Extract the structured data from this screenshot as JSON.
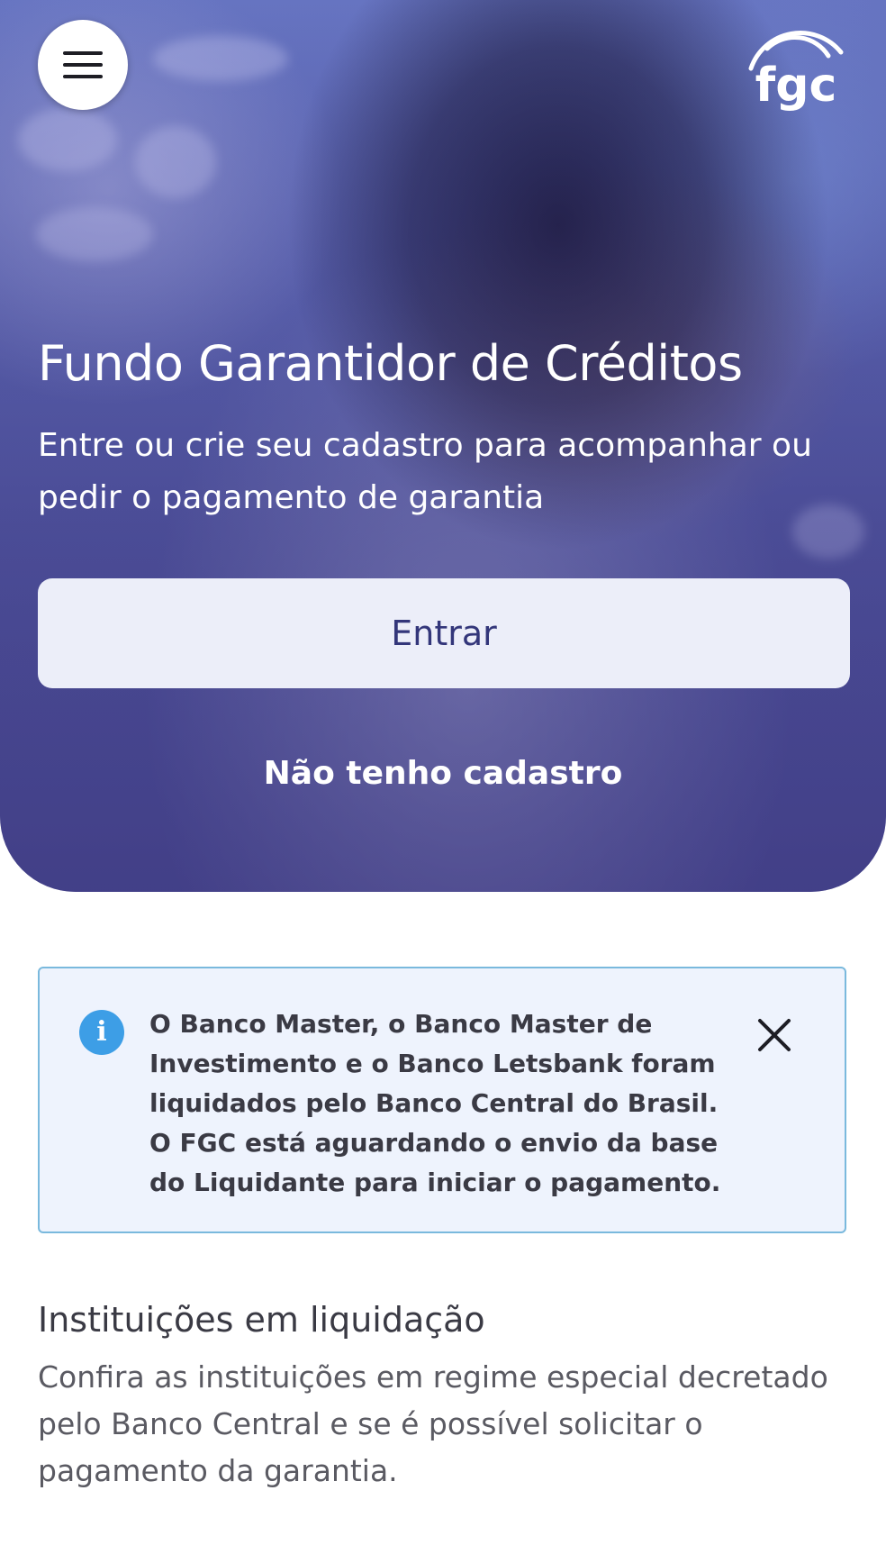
{
  "header": {
    "menu_icon": "hamburger-menu-icon",
    "logo_text": "fgc"
  },
  "hero": {
    "title": "Fundo Garantidor de Créditos",
    "subtitle": "Entre ou crie seu cadastro para acompanhar ou pedir o pagamento de garantia",
    "login_label": "Entrar",
    "register_label": "Não tenho cadastro"
  },
  "alert": {
    "icon": "info-icon",
    "message": "O Banco Master, o Banco Master de Investimento e o Banco Letsbank foram liquidados pelo Banco Central do Brasil. O FGC está aguardando o envio da base do Liquidante para iniciar o pagamento.",
    "close_icon": "close-icon"
  },
  "liquidation_section": {
    "title": "Instituições em liquidação",
    "description": "Confira as instituições em regime especial decretado pelo Banco Central e se é possível solicitar o pagamento da garantia."
  },
  "colors": {
    "hero_overlay": "#4f539b",
    "button_bg": "#eceef9",
    "button_text": "#33367a",
    "alert_border": "#7ab9dd",
    "alert_bg": "#eef3fd",
    "info_icon": "#3d9ee6"
  }
}
